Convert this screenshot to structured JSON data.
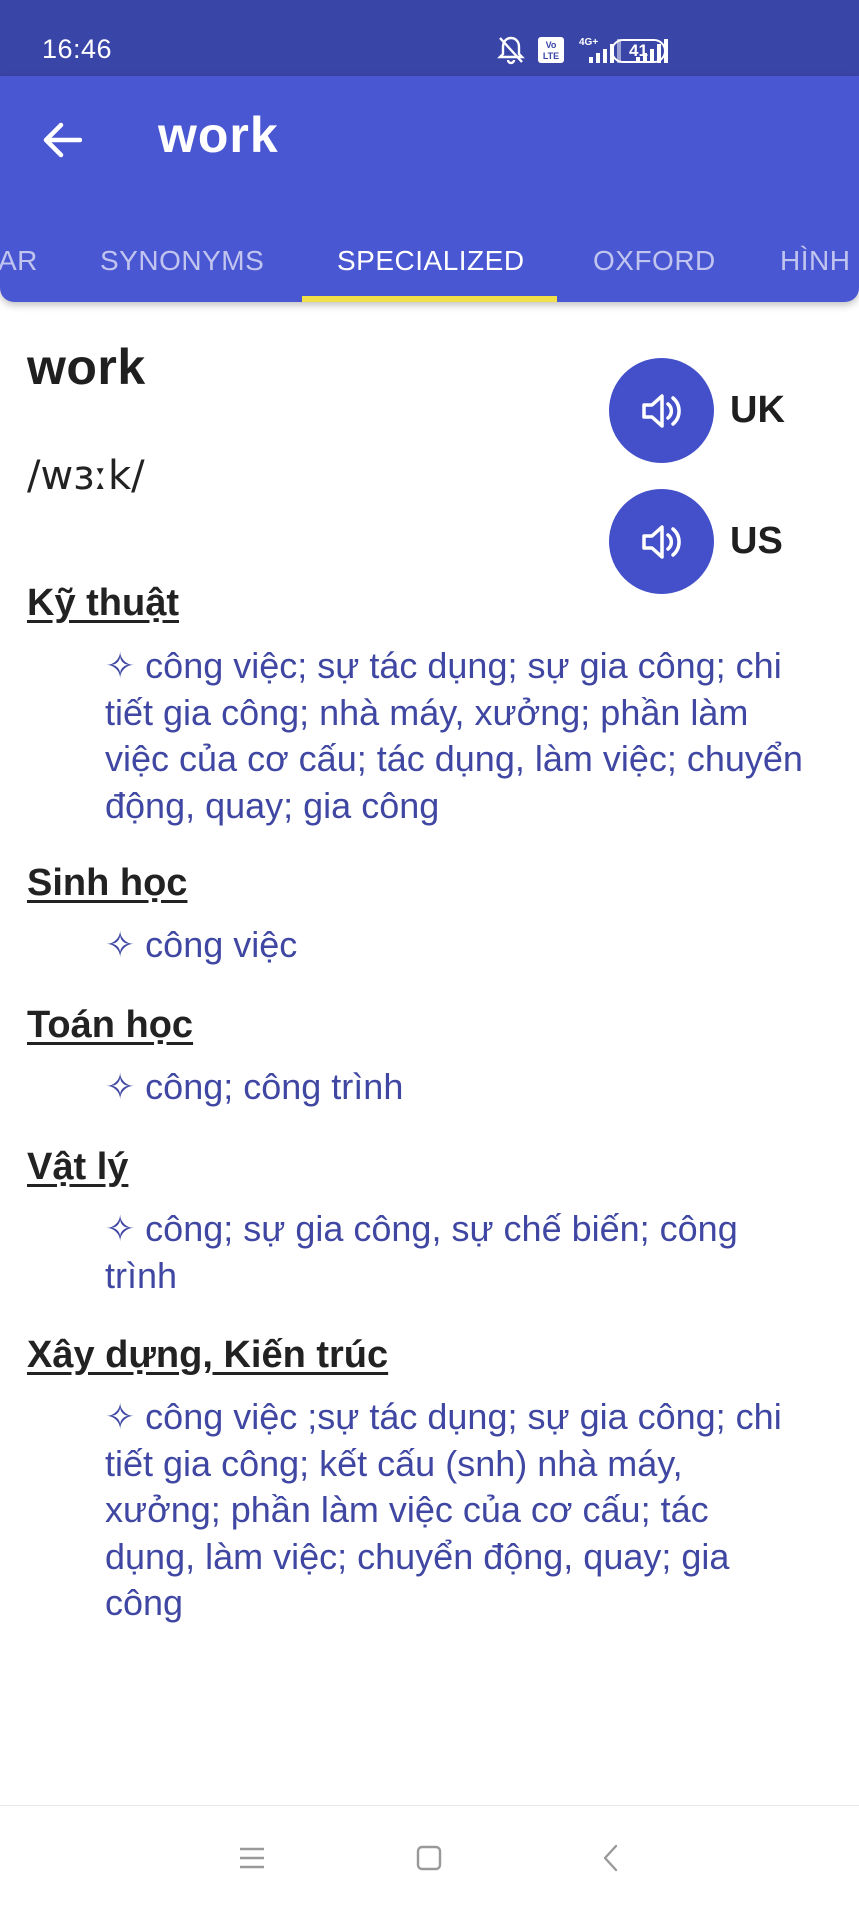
{
  "status_bar": {
    "time": "16:46",
    "battery": "41",
    "icons": [
      "bell-off-icon",
      "volte-icon",
      "signal-4g-icon",
      "signal-icon",
      "battery-icon"
    ]
  },
  "app_bar": {
    "title": "work",
    "back_icon": "arrow-left-icon",
    "background": "#4a57d2"
  },
  "tabs": [
    {
      "label": "AR",
      "active": false
    },
    {
      "label": "SYNONYMS",
      "active": false
    },
    {
      "label": "SPECIALIZED",
      "active": true
    },
    {
      "label": "OXFORD",
      "active": false
    },
    {
      "label": "HÌNH",
      "active": false
    }
  ],
  "entry": {
    "word": "work",
    "phonetic": "/wɜːk/",
    "pronunciations": [
      {
        "label": "UK",
        "icon": "speaker-icon"
      },
      {
        "label": "US",
        "icon": "speaker-icon"
      }
    ]
  },
  "sections": [
    {
      "title": "Kỹ thuật",
      "definition": "✧ công việc; sự tác dụng; sự gia công; chi tiết gia công; nhà máy, xưởng; phần làm việc của cơ cấu; tác dụng, làm việc; chuyển động, quay; gia công"
    },
    {
      "title": "Sinh học",
      "definition": "✧ công việc"
    },
    {
      "title": "Toán học",
      "definition": "✧ công; công trình"
    },
    {
      "title": "Vật lý",
      "definition": "✧ công; sự gia công, sự chế biến; công trình"
    },
    {
      "title": "Xây dựng, Kiến trúc",
      "definition": "✧ công việc ;sự tác dụng; sự gia công; chi tiết gia công; kết cấu (snh) nhà máy, xưởng; phần làm việc của cơ cấu; tác dụng, làm việc; chuyển động, quay; gia công"
    }
  ],
  "nav_bar": {
    "icons": [
      "menu-icon",
      "home-square-icon",
      "back-chevron-icon"
    ]
  },
  "colors": {
    "accent": "#4450c9",
    "tab_indicator": "#f2e04a",
    "definition_text": "#3f47a3"
  }
}
